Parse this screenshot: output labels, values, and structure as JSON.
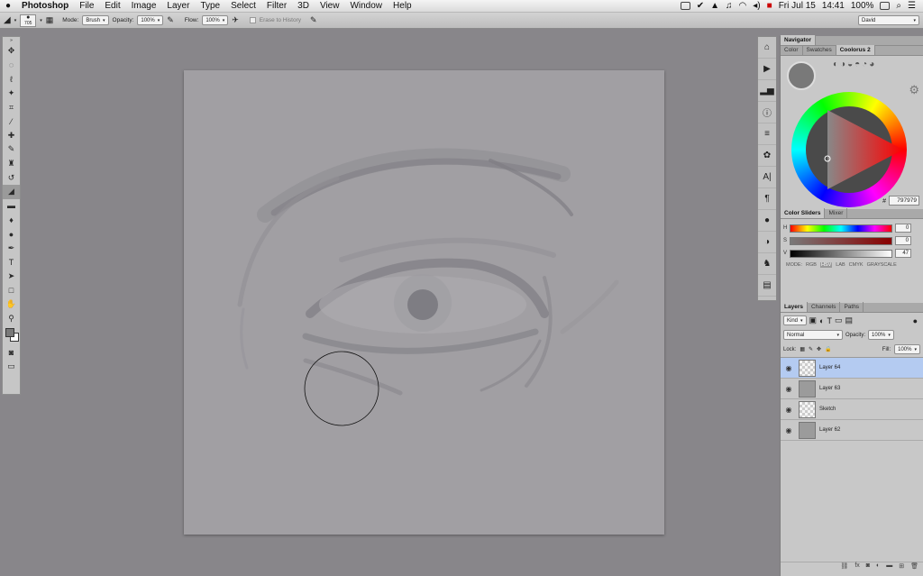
{
  "menu": {
    "apple": "",
    "app": "Photoshop",
    "items": [
      "File",
      "Edit",
      "Image",
      "Layer",
      "Type",
      "Select",
      "Filter",
      "3D",
      "View",
      "Window",
      "Help"
    ],
    "right": {
      "date": "Fri Jul 15",
      "time": "14:41",
      "battery": "100%"
    }
  },
  "options": {
    "brush_size": "705",
    "mode_label": "Mode:",
    "mode_value": "Brush",
    "opacity_label": "Opacity:",
    "opacity_value": "100%",
    "flow_label": "Flow:",
    "flow_value": "100%",
    "erase_history": "Erase to History",
    "workspace": "David"
  },
  "toolbox": {
    "tools": [
      "move-tool",
      "marquee-tool",
      "lasso-tool",
      "quick-select-tool",
      "crop-tool",
      "eyedropper-tool",
      "healing-tool",
      "brush-tool",
      "stamp-tool",
      "history-brush-tool",
      "eraser-tool",
      "gradient-tool",
      "blur-tool",
      "dodge-tool",
      "pen-tool",
      "type-tool",
      "path-select-tool",
      "shape-tool",
      "hand-tool",
      "zoom-tool"
    ]
  },
  "navigator": {
    "title": "Navigator",
    "tabs": [
      "Color",
      "Swatches",
      "Coolorus 2"
    ],
    "hex": "797979"
  },
  "sliders": {
    "tabs": [
      "Color Sliders",
      "Mixer"
    ],
    "h": "0",
    "s": "0",
    "v": "47",
    "modes": [
      "MODE:",
      "RGB",
      "HSV",
      "LAB",
      "CMYK",
      "GRAYSCALE"
    ]
  },
  "layers": {
    "tabs": [
      "Layers",
      "Channels",
      "Paths"
    ],
    "kind": "Kind",
    "blend": "Normal",
    "opacity_label": "Opacity:",
    "opacity": "100%",
    "lock_label": "Lock:",
    "fill_label": "Fill:",
    "fill": "100%",
    "items": [
      {
        "name": "Layer 64"
      },
      {
        "name": "Layer 63"
      },
      {
        "name": "Sketch"
      },
      {
        "name": "Layer 62"
      }
    ]
  },
  "colors": {
    "fg": "#797979",
    "bg": "#ffffff",
    "selected_layer": "#b4cbf1"
  }
}
